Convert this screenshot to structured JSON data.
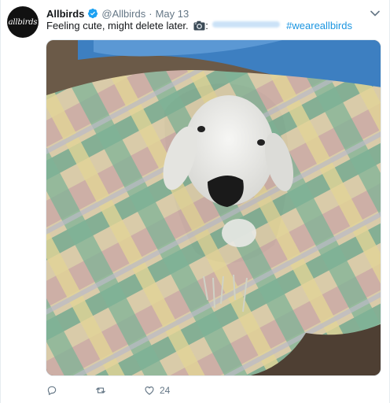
{
  "tweet": {
    "display_name": "Allbirds",
    "handle": "@Allbirds",
    "separator": "·",
    "date": "May 13",
    "avatar_text": "allbirds",
    "text_main": "Feeling cute, might delete later.",
    "text_colon": ":",
    "hashtag": "#weareallbirds",
    "verified_icon": "verified-badge-icon",
    "camera_icon": "camera-emoji-icon",
    "photo_description_icon": "lamb-in-blanket-photo"
  },
  "actions": {
    "reply_icon": "reply-icon",
    "retweet_icon": "retweet-icon",
    "like_icon": "heart-icon",
    "like_count": "24"
  },
  "colors": {
    "link": "#1b95e0",
    "muted": "#657786",
    "verified": "#1da1f2"
  }
}
